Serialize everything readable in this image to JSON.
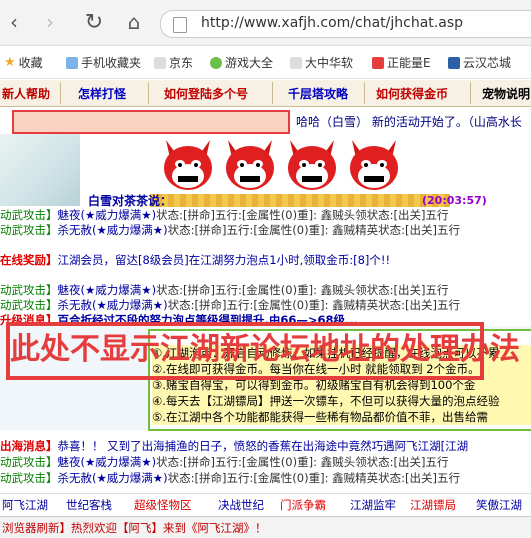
{
  "browser": {
    "url": "http://www.xafjh.com/chat/jhchat.asp"
  },
  "bookmarks": [
    {
      "label": "收藏"
    },
    {
      "label": "手机收藏夹"
    },
    {
      "label": "京东"
    },
    {
      "label": "游戏大全"
    },
    {
      "label": "大中华软"
    },
    {
      "label": "正能量E"
    },
    {
      "label": "云汉芯城"
    }
  ],
  "menu": [
    {
      "label": "新人帮助"
    },
    {
      "label": "怎样打怪"
    },
    {
      "label": "如何登陆多个号"
    },
    {
      "label": "千层塔攻略"
    },
    {
      "label": "如何获得金币"
    },
    {
      "label": "宠物说明"
    }
  ],
  "chatbar": {
    "marquee": "哈哈（白雪）  新的活动开始了。（山高水长"
  },
  "banner": {
    "speaker": "白雪对茶茶说：",
    "time": "(20:03:57)"
  },
  "lines": [
    {
      "a": "动武攻击】",
      "b": "魅夜(★威力爆满★)",
      "c": "状态:[拼命]五行:[金属性(0)重]: 鑫贼头领状态:[出关]五行"
    },
    {
      "a": "动武攻击】",
      "b": "杀无赦(★威力爆满★)",
      "c": "状态:[拼命]五行:[金属性(0)重]: 鑫贼精英状态:[出关]五行"
    },
    {
      "a": "在线奖励】",
      "b": "江湖会员，留达[8级会员]在江湖努力泡点1小时,领取金币:[8]个!!",
      "c": ""
    },
    {
      "a": "动武攻击】",
      "b": "魅夜(★威力爆满★)",
      "c": "状态:[拼命]五行:[金属性(0)重]: 鑫贼头领状态:[出关]五行"
    },
    {
      "a": "动武攻击】",
      "b": "杀无赦(★威力爆满★)",
      "c": "状态:[拼命]五行:[金属性(0)重]: 鑫贼精英状态:[出关]五行"
    },
    {
      "a": "升级消息】",
      "b": "百合折经过不段的努力泡点等级得到提升,由66—>68级...",
      "c": ""
    }
  ],
  "overlay": {
    "label": "此处不显示江湖新论坛地址的处理办法",
    "notices": [
      "①.江湖泡点：开启自动修炼，如果挂机已经提醒，在线泡点可以不累",
      "②.在线即可获得金币。每当你在线一小时 就能领取到 2个金币。",
      "③.赌宝自得宝，可以得到金币。初级赌宝自有机会得到100个金",
      "④.每天去【江湖镖局】押送一次镖车，不但可以获得大量的泡点经验",
      "⑤.在江湖中各个功能都能获得一些稀有物品都价值不菲，出售给需"
    ]
  },
  "lines2": [
    {
      "a": "出海消息】",
      "b": "恭喜！！ 又到了出海捕渔的日子，愤怒的香蕉在出海途中竟然巧遇阿飞江湖[江湖"
    },
    {
      "a": "动武攻击】",
      "b": "魅夜(★威力爆满★)",
      "c": "状态:[拼命]五行:[金属性(0)重]: 鑫贼头领状态:[出关]五行"
    },
    {
      "a": "动武攻击】",
      "b": "杀无赦(★威力爆满★)",
      "c": "状态:[拼命]五行:[金属性(0)重]: 鑫贼精英状态:[出关]五行"
    }
  ],
  "tabs": [
    {
      "label": "阿飞江湖"
    },
    {
      "label": "世纪客栈"
    },
    {
      "label": "超级怪物区"
    },
    {
      "label": "决战世纪"
    },
    {
      "label": "门派争霸"
    },
    {
      "label": "江湖监牢"
    },
    {
      "label": "江湖镖局"
    },
    {
      "label": "笑傲江湖"
    }
  ],
  "status": {
    "text": "浏览器刷新】热烈欢迎【阿飞】来到《阿飞江湖》！"
  }
}
